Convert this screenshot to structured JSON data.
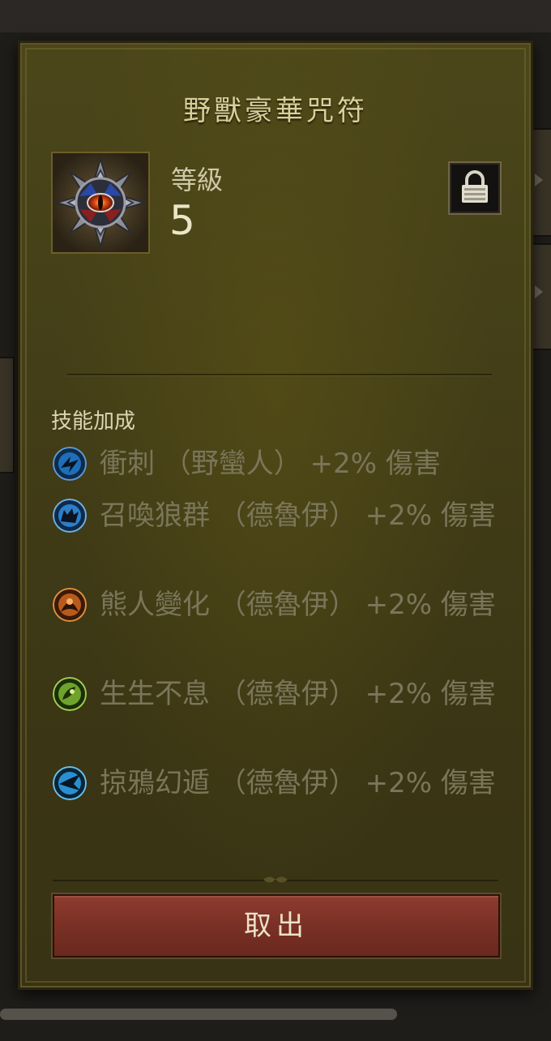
{
  "panel": {
    "title": "野獸豪華咒符",
    "level_label": "等級",
    "level_value": "5",
    "lock_icon": "padlock-icon"
  },
  "skills": {
    "section_label": "技能加成",
    "items": [
      {
        "text": "衝刺 （野蠻人） +2% 傷害",
        "icon": "charge-skill-icon",
        "color": "#1e6fb8"
      },
      {
        "text": "召喚狼群 （德魯伊） +2% 傷害",
        "icon": "wolves-skill-icon",
        "color": "#2b7fc9"
      },
      {
        "text": "熊人變化 （德魯伊） +2% 傷害",
        "icon": "werebear-skill-icon",
        "color": "#b85a1e"
      },
      {
        "text": "生生不息 （德魯伊） +2% 傷害",
        "icon": "nature-skill-icon",
        "color": "#6fa32c"
      },
      {
        "text": "掠鴉幻遁 （德魯伊） +2% 傷害",
        "icon": "raven-skill-icon",
        "color": "#2a8fd0"
      }
    ]
  },
  "actions": {
    "take_out_label": "取出"
  },
  "colors": {
    "panel": "#423d17",
    "button": "#7a3025",
    "title": "#d8cf9a"
  }
}
